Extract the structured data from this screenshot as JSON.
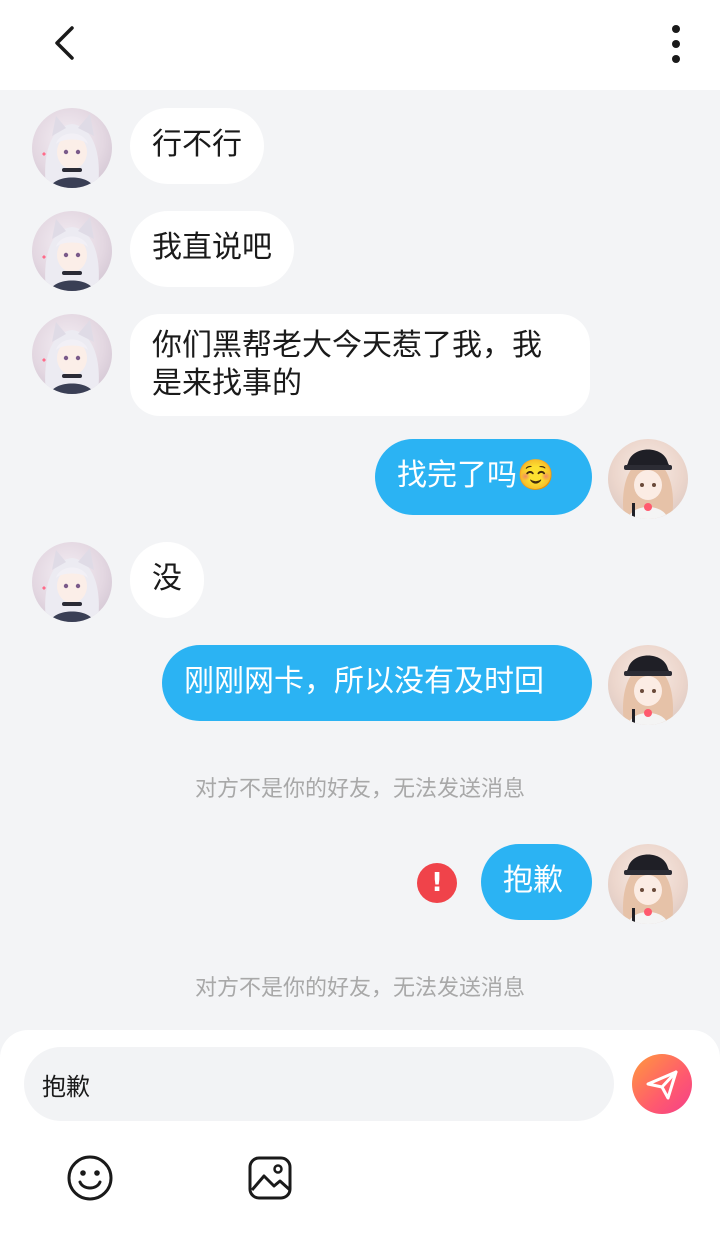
{
  "header": {
    "back_icon": "chevron-left-icon",
    "menu_icon": "vertical-dots-icon"
  },
  "messages": [
    {
      "side": "in",
      "text": "行不行",
      "avatar": "anime-girl-white-hair"
    },
    {
      "side": "in",
      "text": "我直说吧",
      "avatar": "anime-girl-white-hair"
    },
    {
      "side": "in",
      "text": "你们黑帮老大今天惹了我，我是来找事的",
      "avatar": "anime-girl-white-hair"
    },
    {
      "side": "out",
      "text": "找完了吗☺️",
      "avatar": "anime-girl-black-cap"
    },
    {
      "side": "in",
      "text": "没",
      "avatar": "anime-girl-white-hair"
    },
    {
      "side": "out",
      "text": "刚刚网卡，所以没有及时回",
      "avatar": "anime-girl-black-cap"
    },
    {
      "side": "system",
      "text": "对方不是你的好友，无法发送消息"
    },
    {
      "side": "out",
      "text": "抱歉",
      "avatar": "anime-girl-black-cap",
      "failed": true,
      "failed_mark": "!"
    },
    {
      "side": "system",
      "text": "对方不是你的好友，无法发送消息"
    }
  ],
  "composer": {
    "value": "抱歉",
    "send_icon": "paper-plane-icon",
    "emoji_icon": "smiley-face-icon",
    "image_icon": "image-icon"
  },
  "colors": {
    "outgoing_bubble": "#2bb3f3",
    "incoming_bubble": "#ffffff",
    "background": "#f3f4f6",
    "error": "#f0434a",
    "send_gradient_start": "#ff9a3c",
    "send_gradient_end": "#f43f8a"
  }
}
